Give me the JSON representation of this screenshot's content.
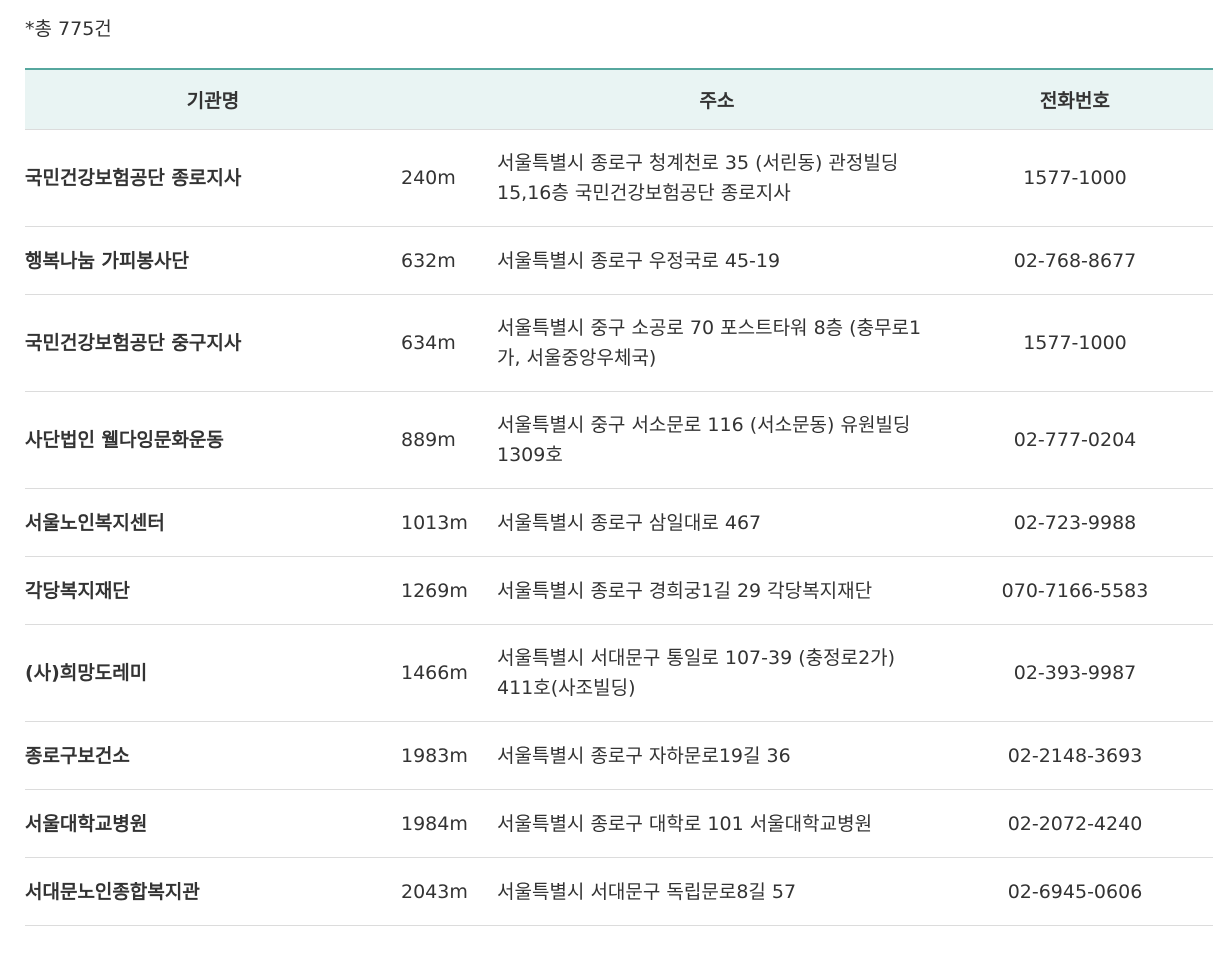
{
  "summary": {
    "total_label": "*총 775건"
  },
  "table": {
    "headers": {
      "name": "기관명",
      "address": "주소",
      "phone": "전화번호"
    },
    "rows": [
      {
        "name": "국민건강보험공단 종로지사",
        "distance": "240m",
        "address": "서울특별시 종로구 청계천로 35 (서린동) 관정빌딩 15,16층 국민건강보험공단 종로지사",
        "phone": "1577-1000"
      },
      {
        "name": "행복나눔 가피봉사단",
        "distance": "632m",
        "address": "서울특별시 종로구 우정국로 45-19",
        "phone": "02-768-8677"
      },
      {
        "name": "국민건강보험공단 중구지사",
        "distance": "634m",
        "address": "서울특별시 중구 소공로 70 포스트타워 8층 (충무로1가, 서울중앙우체국)",
        "phone": "1577-1000"
      },
      {
        "name": "사단법인 웰다잉문화운동",
        "distance": "889m",
        "address": "서울특별시 중구 서소문로 116 (서소문동) 유원빌딩 1309호",
        "phone": "02-777-0204"
      },
      {
        "name": "서울노인복지센터",
        "distance": "1013m",
        "address": "서울특별시 종로구 삼일대로 467",
        "phone": "02-723-9988"
      },
      {
        "name": "각당복지재단",
        "distance": "1269m",
        "address": "서울특별시 종로구 경희궁1길 29 각당복지재단",
        "phone": "070-7166-5583"
      },
      {
        "name": "(사)희망도레미",
        "distance": "1466m",
        "address": "서울특별시 서대문구 통일로 107-39 (충정로2가) 411호(사조빌딩)",
        "phone": "02-393-9987"
      },
      {
        "name": "종로구보건소",
        "distance": "1983m",
        "address": "서울특별시 종로구 자하문로19길 36",
        "phone": "02-2148-3693"
      },
      {
        "name": "서울대학교병원",
        "distance": "1984m",
        "address": "서울특별시 종로구 대학로 101 서울대학교병원",
        "phone": "02-2072-4240"
      },
      {
        "name": "서대문노인종합복지관",
        "distance": "2043m",
        "address": "서울특별시 서대문구 독립문로8길 57",
        "phone": "02-6945-0606"
      }
    ]
  }
}
